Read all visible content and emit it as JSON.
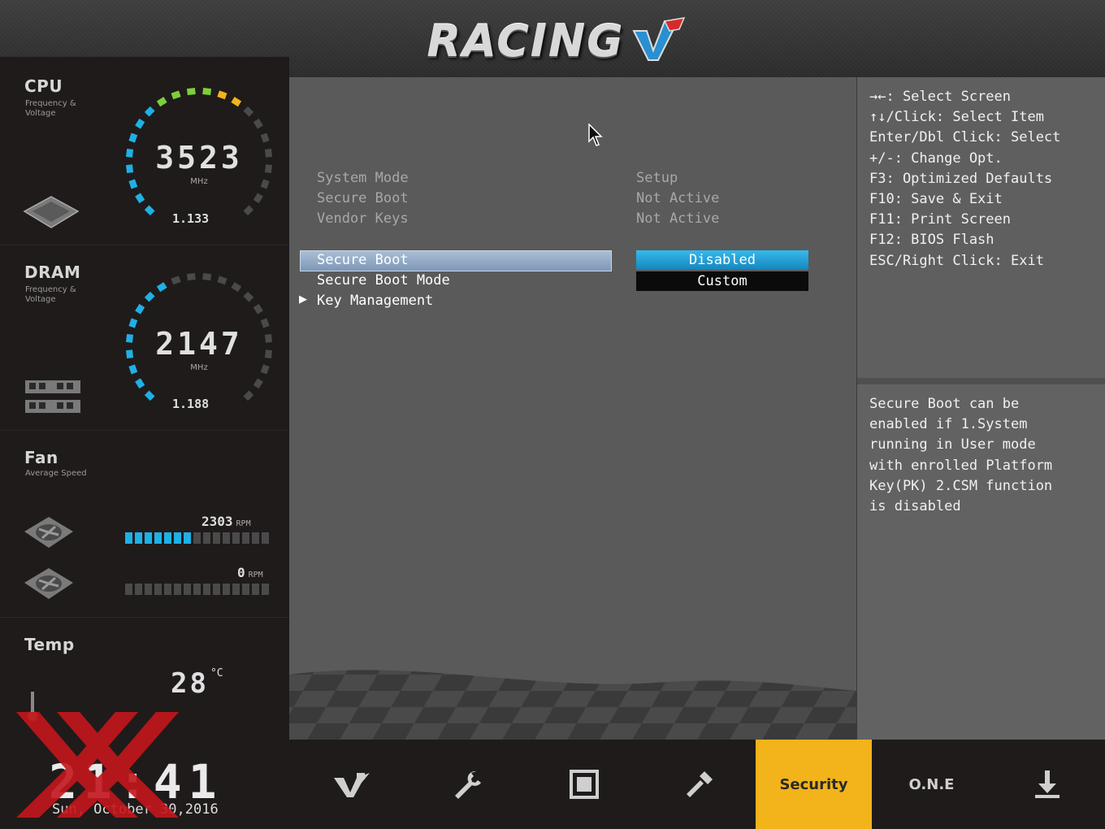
{
  "header": {
    "logo_text": "RACING"
  },
  "sidebar": {
    "cpu": {
      "title": "CPU",
      "subtitle": "Frequency & Voltage",
      "value": "3523",
      "unit": "MHz",
      "voltage": "1.133"
    },
    "dram": {
      "title": "DRAM",
      "subtitle": "Frequency & Voltage",
      "value": "2147",
      "unit": "MHz",
      "voltage": "1.188"
    },
    "fan": {
      "title": "Fan",
      "subtitle": "Average Speed",
      "fans": [
        {
          "rpm": "2303",
          "unit": "RPM",
          "level_segments": 7,
          "total_segments": 15
        },
        {
          "rpm": "0",
          "unit": "RPM",
          "level_segments": 0,
          "total_segments": 15
        }
      ]
    },
    "temp": {
      "title": "Temp",
      "value": "28",
      "unit": "°C"
    }
  },
  "main": {
    "info_rows": [
      {
        "label": "System Mode",
        "value": "Setup"
      },
      {
        "label": "Secure Boot",
        "value": "Not Active"
      },
      {
        "label": "Vendor Keys",
        "value": "Not Active"
      }
    ],
    "options": [
      {
        "label": "Secure Boot",
        "value": "Disabled",
        "selected": true
      },
      {
        "label": "Secure Boot Mode",
        "value": "Custom"
      },
      {
        "label": "Key Management",
        "submenu": true
      }
    ]
  },
  "help": {
    "keys": [
      "→←: Select Screen",
      "↑↓/Click: Select Item",
      "Enter/Dbl Click: Select",
      "+/-: Change Opt.",
      "F3: Optimized Defaults",
      "F10: Save & Exit",
      "F11: Print Screen",
      "F12: BIOS Flash",
      "ESC/Right Click: Exit"
    ],
    "description": [
      "Secure Boot can be",
      "enabled if 1.System",
      "running in User mode",
      "with enrolled Platform",
      "Key(PK) 2.CSM function",
      "is disabled"
    ]
  },
  "bottom": {
    "time": "21:41",
    "date": "Sun, October  30,2016",
    "tabs": [
      {
        "name": "main-icon"
      },
      {
        "name": "wrench-icon"
      },
      {
        "name": "chip-icon"
      },
      {
        "name": "tools-icon"
      },
      {
        "name": "security",
        "label": "Security",
        "active": true
      },
      {
        "name": "one",
        "label": "O.N.E"
      },
      {
        "name": "download-icon"
      }
    ]
  },
  "colors": {
    "accent_blue": "#1fb0e6",
    "active_tab": "#f2b31b",
    "selection": "#8aa3c0"
  }
}
